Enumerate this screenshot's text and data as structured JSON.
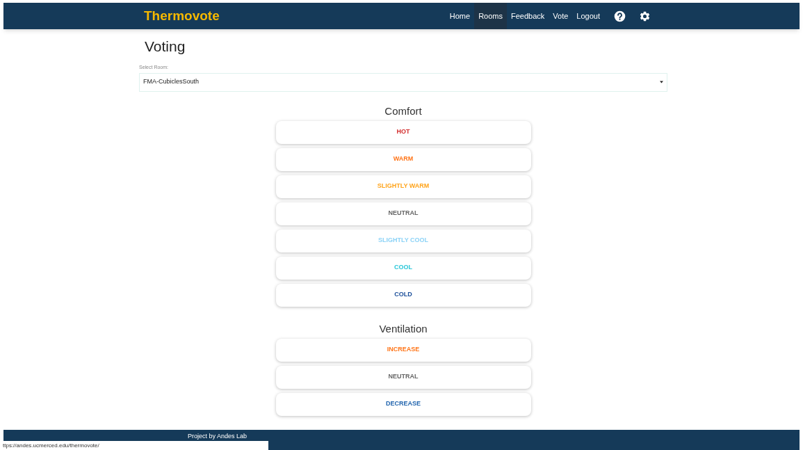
{
  "header": {
    "brand": "Thermovote",
    "nav": [
      {
        "label": "Home",
        "selected": false
      },
      {
        "label": "Rooms",
        "selected": true
      },
      {
        "label": "Feedback",
        "selected": false
      },
      {
        "label": "Vote",
        "selected": false
      },
      {
        "label": "Logout",
        "selected": false
      }
    ]
  },
  "page_title": "Voting",
  "room_select": {
    "label": "Select Room:",
    "value": "FMA-CubiclesSouth"
  },
  "sections": [
    {
      "title": "Comfort",
      "options": [
        {
          "label": "HOT",
          "color": "#d32f2f"
        },
        {
          "label": "WARM",
          "color": "#ff7417"
        },
        {
          "label": "SLIGHTLY WARM",
          "color": "#ffa41b"
        },
        {
          "label": "NEUTRAL",
          "color": "#666666"
        },
        {
          "label": "SLIGHTLY COOL",
          "color": "#8dd3f7"
        },
        {
          "label": "COOL",
          "color": "#29c7d9"
        },
        {
          "label": "COLD",
          "color": "#1c4f9a"
        }
      ]
    },
    {
      "title": "Ventilation",
      "options": [
        {
          "label": "INCREASE",
          "color": "#ff7417"
        },
        {
          "label": "NEUTRAL",
          "color": "#666666"
        },
        {
          "label": "DECREASE",
          "color": "#1f63ad"
        }
      ]
    }
  ],
  "footer": {
    "text": "Project by Andes Lab"
  },
  "status_url": "ttps://andes.ucmerced.edu/thermovote/"
}
